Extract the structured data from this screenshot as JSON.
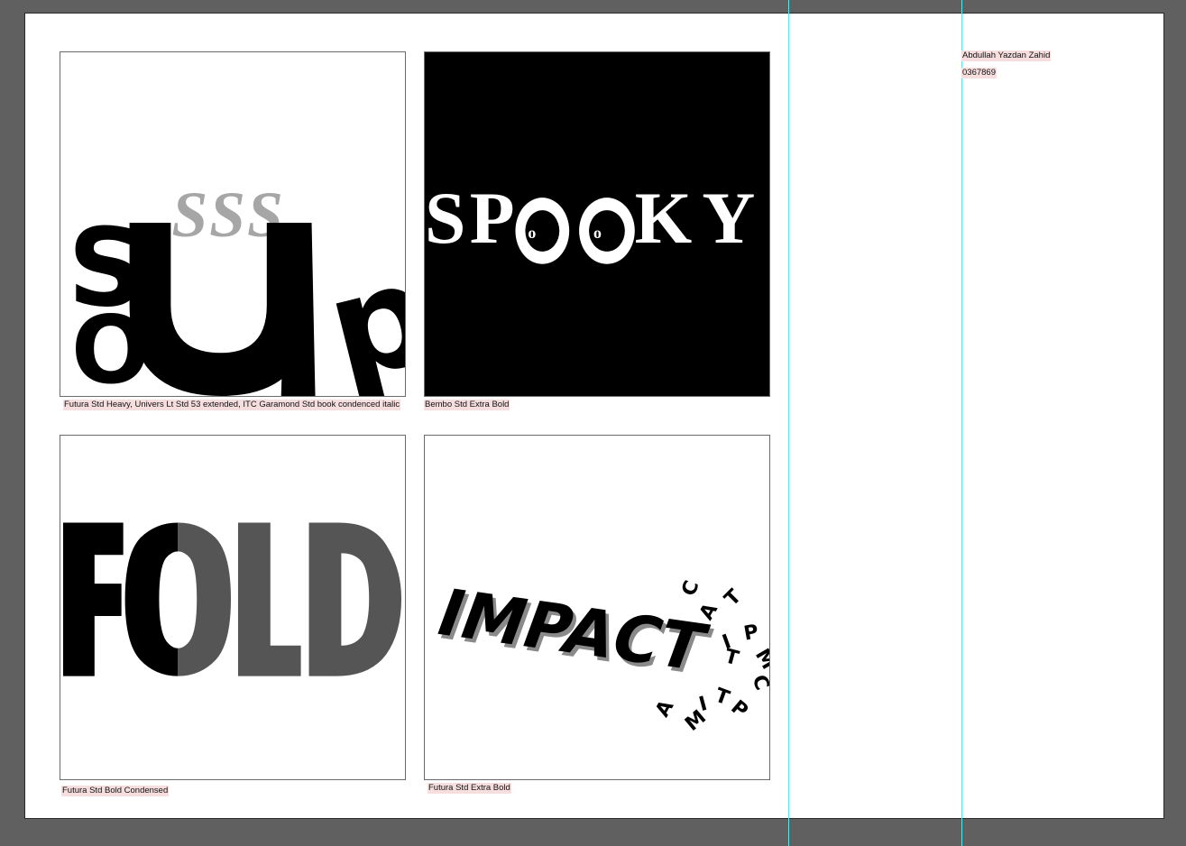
{
  "page": {
    "background": "#606060",
    "paper": "#ffffff",
    "guide_color": "#5fe3ea"
  },
  "author": {
    "name": "Abdullah Yazdan Zahid",
    "id": "0367869"
  },
  "artworks": [
    {
      "name": "soup",
      "caption": "Futura Std Heavy, Univers Lt Std 53 extended, ITC Garamond Std book condenced italic",
      "letters": {
        "sss": "SSS",
        "s": "S",
        "o": "O",
        "p": "p"
      },
      "colors": {
        "ink": "#000000",
        "grey": "#a6a6a6"
      }
    },
    {
      "name": "spooky",
      "caption": "Bembo Std Extra Bold",
      "letters": {
        "s": "S",
        "p": "P",
        "k": "K",
        "y": "Y",
        "pupil": "o"
      },
      "colors": {
        "bg": "#000000",
        "ink": "#ffffff"
      }
    },
    {
      "name": "fold",
      "caption": "Futura Std Bold Condensed",
      "letters": {
        "f": "F",
        "o": "O",
        "l": "L",
        "d": "D"
      },
      "colors": {
        "ink": "#000000",
        "grey": "#555555"
      }
    },
    {
      "name": "impact",
      "caption": "Futura Std Extra Bold",
      "word": "IMPACT",
      "scatter": [
        "C",
        "A",
        "T",
        "I",
        "P",
        "T",
        "M",
        "C",
        "P",
        "T",
        "I",
        "M",
        "A"
      ],
      "colors": {
        "ink": "#000000",
        "shadow": "#8a8a8a"
      }
    }
  ]
}
